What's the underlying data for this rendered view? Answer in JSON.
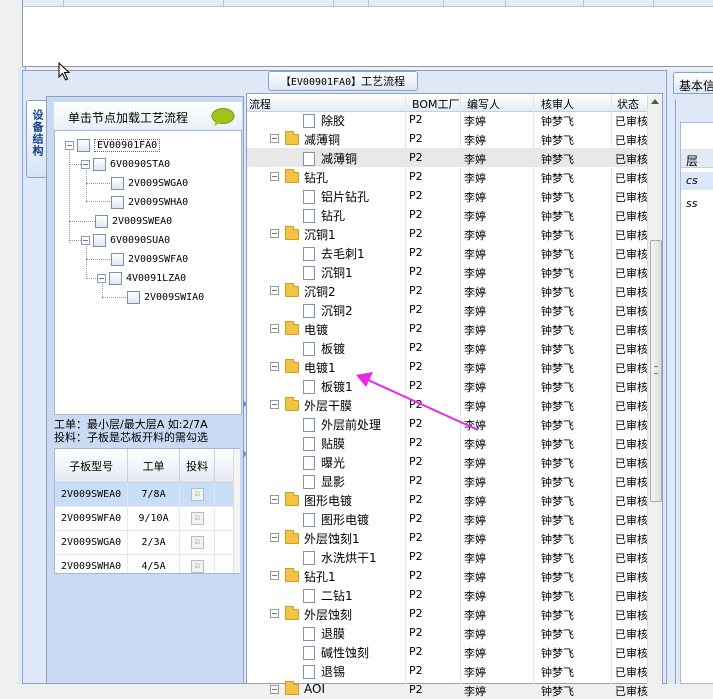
{
  "tabs": {
    "left_vertical_tab": "设备结构",
    "process_panel_title_code": "【EV00901FA0】",
    "process_panel_title_text": "工艺流程",
    "right_panel_title": "基本信息"
  },
  "left_panel": {
    "hint": "单击节点加载工艺流程",
    "tree": [
      {
        "label": "EV00901FA0",
        "selected": true
      },
      {
        "label": "6V0090STA0"
      },
      {
        "label": "2V009SWGA0"
      },
      {
        "label": "2V009SWHA0"
      },
      {
        "label": "2V009SWEA0"
      },
      {
        "label": "6V0090SUA0"
      },
      {
        "label": "2V009SWFA0"
      },
      {
        "label": "4V0091LZA0"
      },
      {
        "label": "2V009SWIA0"
      }
    ],
    "note1": "工单：最小层/最大层A 如:2/7A",
    "note2": "投料：子板是芯板开料的需勾选",
    "subgrid": {
      "headers": [
        "子板型号",
        "工单",
        "投料"
      ],
      "rows": [
        {
          "model": "2V009SWEA0",
          "order": "7/8A",
          "feed": "☑",
          "selected": true
        },
        {
          "model": "2V009SWFA0",
          "order": "9/10A",
          "feed": "☑"
        },
        {
          "model": "2V009SWGA0",
          "order": "2/3A",
          "feed": "☑"
        },
        {
          "model": "2V009SWHA0",
          "order": "4/5A",
          "feed": "☑"
        }
      ]
    }
  },
  "process_grid": {
    "columns": [
      "流程",
      "BOM工厂",
      "编写人",
      "核审人",
      "状态"
    ],
    "rows": [
      {
        "type": "file",
        "name": "除胶",
        "factory": "P2",
        "writer": "李婷",
        "reviewer": "钟梦飞",
        "status": "已审核"
      },
      {
        "type": "folder",
        "name": "减薄铜",
        "factory": "P2",
        "writer": "李婷",
        "reviewer": "钟梦飞",
        "status": "已审核"
      },
      {
        "type": "file",
        "name": "减薄铜",
        "factory": "P2",
        "writer": "李婷",
        "reviewer": "钟梦飞",
        "status": "已审核",
        "highlight": true
      },
      {
        "type": "folder",
        "name": "钻孔",
        "factory": "P2",
        "writer": "李婷",
        "reviewer": "钟梦飞",
        "status": "已审核"
      },
      {
        "type": "file",
        "name": "铝片钻孔",
        "factory": "P2",
        "writer": "李婷",
        "reviewer": "钟梦飞",
        "status": "已审核"
      },
      {
        "type": "file",
        "name": "钻孔",
        "factory": "P2",
        "writer": "李婷",
        "reviewer": "钟梦飞",
        "status": "已审核"
      },
      {
        "type": "folder",
        "name": "沉铜1",
        "factory": "P2",
        "writer": "李婷",
        "reviewer": "钟梦飞",
        "status": "已审核"
      },
      {
        "type": "file",
        "name": "去毛刺1",
        "factory": "P2",
        "writer": "李婷",
        "reviewer": "钟梦飞",
        "status": "已审核"
      },
      {
        "type": "file",
        "name": "沉铜1",
        "factory": "P2",
        "writer": "李婷",
        "reviewer": "钟梦飞",
        "status": "已审核"
      },
      {
        "type": "folder",
        "name": "沉铜2",
        "factory": "P2",
        "writer": "李婷",
        "reviewer": "钟梦飞",
        "status": "已审核"
      },
      {
        "type": "file",
        "name": "沉铜2",
        "factory": "P2",
        "writer": "李婷",
        "reviewer": "钟梦飞",
        "status": "已审核"
      },
      {
        "type": "folder",
        "name": "电镀",
        "factory": "P2",
        "writer": "李婷",
        "reviewer": "钟梦飞",
        "status": "已审核"
      },
      {
        "type": "file",
        "name": "板镀",
        "factory": "P2",
        "writer": "李婷",
        "reviewer": "钟梦飞",
        "status": "已审核"
      },
      {
        "type": "folder",
        "name": "电镀1",
        "factory": "P2",
        "writer": "李婷",
        "reviewer": "钟梦飞",
        "status": "已审核"
      },
      {
        "type": "file",
        "name": "板镀1",
        "factory": "P2",
        "writer": "李婷",
        "reviewer": "钟梦飞",
        "status": "已审核"
      },
      {
        "type": "folder",
        "name": "外层干膜",
        "factory": "P2",
        "writer": "李婷",
        "reviewer": "钟梦飞",
        "status": "已审核"
      },
      {
        "type": "file",
        "name": "外层前处理",
        "factory": "P2",
        "writer": "李婷",
        "reviewer": "钟梦飞",
        "status": "已审核"
      },
      {
        "type": "file",
        "name": "贴膜",
        "factory": "P2",
        "writer": "李婷",
        "reviewer": "钟梦飞",
        "status": "已审核"
      },
      {
        "type": "file",
        "name": "曝光",
        "factory": "P2",
        "writer": "李婷",
        "reviewer": "钟梦飞",
        "status": "已审核"
      },
      {
        "type": "file",
        "name": "显影",
        "factory": "P2",
        "writer": "李婷",
        "reviewer": "钟梦飞",
        "status": "已审核"
      },
      {
        "type": "folder",
        "name": "图形电镀",
        "factory": "P2",
        "writer": "李婷",
        "reviewer": "钟梦飞",
        "status": "已审核"
      },
      {
        "type": "file",
        "name": "图形电镀",
        "factory": "P2",
        "writer": "李婷",
        "reviewer": "钟梦飞",
        "status": "已审核"
      },
      {
        "type": "folder",
        "name": "外层蚀刻1",
        "factory": "P2",
        "writer": "李婷",
        "reviewer": "钟梦飞",
        "status": "已审核"
      },
      {
        "type": "file",
        "name": "水洗烘干1",
        "factory": "P2",
        "writer": "李婷",
        "reviewer": "钟梦飞",
        "status": "已审核"
      },
      {
        "type": "folder",
        "name": "钻孔1",
        "factory": "P2",
        "writer": "李婷",
        "reviewer": "钟梦飞",
        "status": "已审核"
      },
      {
        "type": "file",
        "name": "二钻1",
        "factory": "P2",
        "writer": "李婷",
        "reviewer": "钟梦飞",
        "status": "已审核"
      },
      {
        "type": "folder",
        "name": "外层蚀刻",
        "factory": "P2",
        "writer": "李婷",
        "reviewer": "钟梦飞",
        "status": "已审核"
      },
      {
        "type": "file",
        "name": "退膜",
        "factory": "P2",
        "writer": "李婷",
        "reviewer": "钟梦飞",
        "status": "已审核"
      },
      {
        "type": "file",
        "name": "碱性蚀刻",
        "factory": "P2",
        "writer": "李婷",
        "reviewer": "钟梦飞",
        "status": "已审核"
      },
      {
        "type": "file",
        "name": "退锡",
        "factory": "P2",
        "writer": "李婷",
        "reviewer": "钟梦飞",
        "status": "已审核"
      },
      {
        "type": "folder",
        "name": "AOI",
        "factory": "P2",
        "writer": "李婷",
        "reviewer": "钟梦飞",
        "status": "已审核"
      }
    ]
  },
  "right_panel": {
    "header": "层",
    "rows": [
      "cs",
      "ss"
    ]
  },
  "annotation": {
    "color": "#e62ae6",
    "target_row": "板镀1"
  }
}
